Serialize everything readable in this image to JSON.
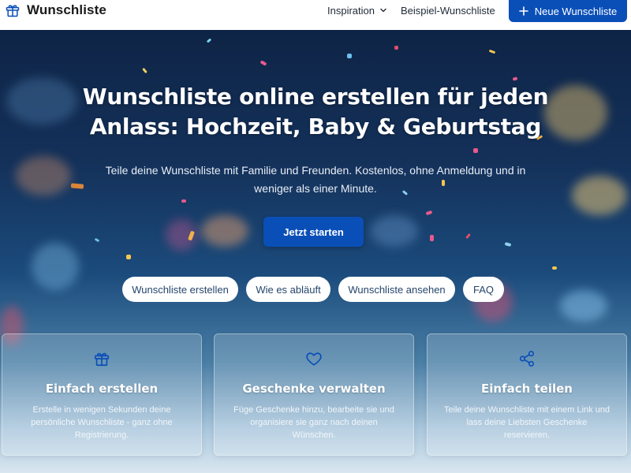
{
  "header": {
    "brand_name": "Wunschliste",
    "brand_icon": "gift-icon",
    "nav": {
      "inspiration_label": "Inspiration",
      "example_label": "Beispiel-Wunschliste"
    },
    "new_button_label": "Neue Wunschliste",
    "accent_color": "#0a4fb8"
  },
  "hero": {
    "title": "Wunschliste online erstellen für jeden Anlass: Hochzeit, Baby & Geburtstag",
    "subtitle": "Teile deine Wunschliste mit Familie und Freunden. Kostenlos, ohne Anmeldung und in weniger als einer Minute.",
    "cta_label": "Jetzt starten",
    "quick_links": [
      {
        "label": "Wunschliste erstellen"
      },
      {
        "label": "Wie es abläuft"
      },
      {
        "label": "Wunschliste ansehen"
      },
      {
        "label": "FAQ"
      }
    ]
  },
  "features": [
    {
      "icon": "gift-icon",
      "title": "Einfach erstellen",
      "description": "Erstelle in wenigen Sekunden deine persönliche Wunschliste - ganz ohne Registrierung."
    },
    {
      "icon": "heart-icon",
      "title": "Geschenke verwalten",
      "description": "Füge Geschenke hinzu, bearbeite sie und organisiere sie ganz nach deinen Wünschen."
    },
    {
      "icon": "share-icon",
      "title": "Einfach teilen",
      "description": "Teile deine Wunschliste mit einem Link und lass deine Liebsten Geschenke reservieren."
    }
  ]
}
